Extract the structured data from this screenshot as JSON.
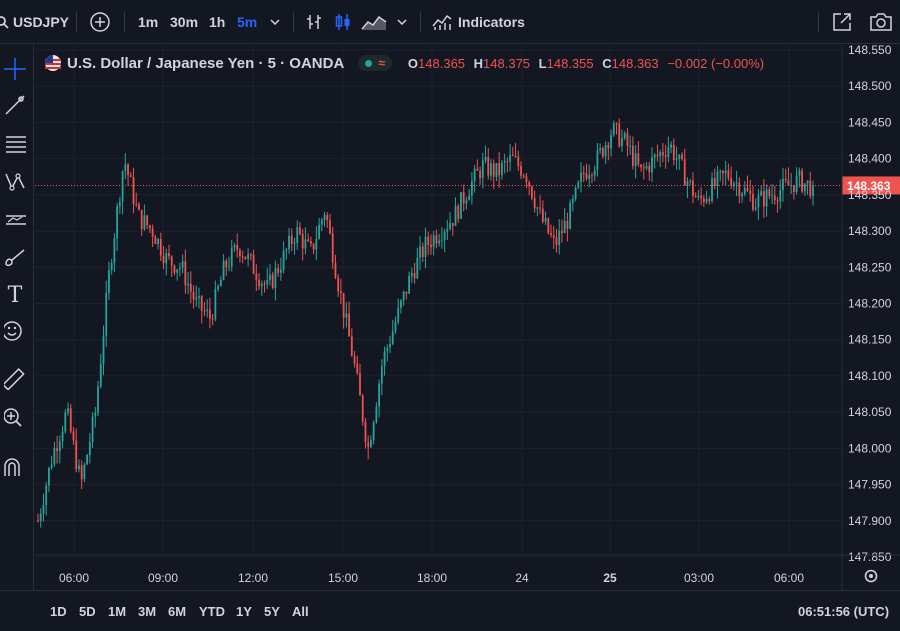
{
  "header": {
    "symbol": "USDJPY",
    "intervals": [
      {
        "label": "1m",
        "active": false
      },
      {
        "label": "30m",
        "active": false
      },
      {
        "label": "1h",
        "active": false
      },
      {
        "label": "5m",
        "active": true
      }
    ],
    "indicators_label": "Indicators"
  },
  "legend": {
    "title": "U.S. Dollar / Japanese Yen · 5 · OANDA",
    "o_label": "O",
    "o_value": "148.365",
    "h_label": "H",
    "h_value": "148.375",
    "l_label": "L",
    "l_value": "148.355",
    "c_label": "C",
    "c_value": "148.363",
    "change": "−0.002 (−0.00%)"
  },
  "price_axis": {
    "ticks": [
      "148.550",
      "148.500",
      "148.450",
      "148.400",
      "148.350",
      "148.300",
      "148.250",
      "148.200",
      "148.150",
      "148.100",
      "148.050",
      "148.000",
      "147.950",
      "147.900",
      "147.850"
    ],
    "current_price_label": "148.363"
  },
  "time_axis": {
    "ticks": [
      "06:00",
      "09:00",
      "12:00",
      "15:00",
      "18:00",
      "24",
      "25",
      "03:00",
      "06:00"
    ]
  },
  "footer": {
    "ranges": [
      "1D",
      "5D",
      "1M",
      "3M",
      "6M",
      "YTD",
      "1Y",
      "5Y",
      "All"
    ],
    "clock": "06:51:56 (UTC)"
  },
  "colors": {
    "background": "#131722",
    "up": "#26a69a",
    "down": "#ef5350",
    "accent": "#2962ff",
    "text": "#d1d4dc"
  },
  "chart_data": {
    "type": "candlestick",
    "ylim": [
      147.85,
      148.55
    ],
    "current_price": 148.363,
    "x_ticks": [
      "06:00",
      "09:00",
      "12:00",
      "15:00",
      "18:00",
      "24",
      "25",
      "03:00",
      "06:00"
    ],
    "close_path": [
      147.9,
      147.99,
      148.05,
      147.95,
      148.05,
      148.25,
      148.4,
      148.32,
      148.3,
      148.26,
      148.25,
      148.2,
      148.18,
      148.25,
      148.28,
      148.25,
      148.22,
      148.26,
      148.3,
      148.27,
      148.33,
      148.22,
      148.12,
      148.0,
      148.12,
      148.18,
      148.24,
      148.28,
      148.3,
      148.32,
      148.36,
      148.39,
      148.38,
      148.4,
      148.38,
      148.32,
      148.28,
      148.32,
      148.38,
      148.4,
      148.44,
      148.42,
      148.38,
      148.4,
      148.42,
      148.38,
      148.34,
      148.36,
      148.38,
      148.36,
      148.34,
      148.35,
      148.36,
      148.37,
      148.36
    ]
  }
}
